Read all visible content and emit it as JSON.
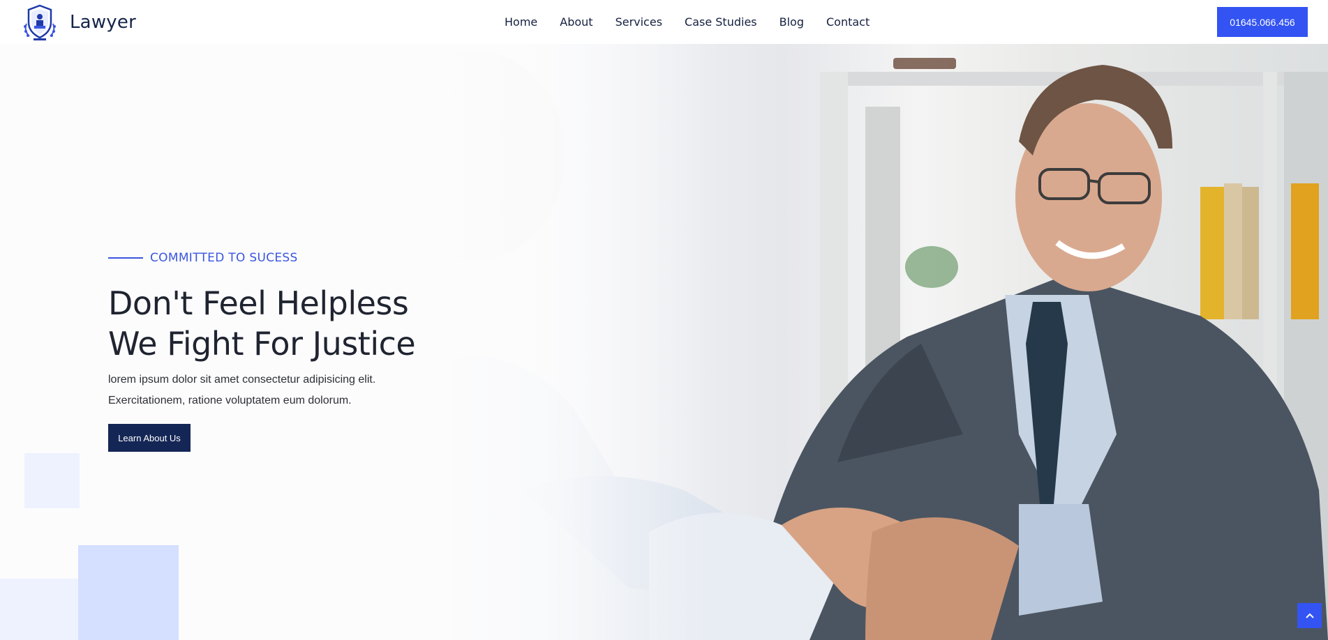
{
  "brand": {
    "name": "Lawyer",
    "logo_icon": "lawyer-shield-emblem-icon"
  },
  "nav": {
    "items": [
      {
        "label": "Home"
      },
      {
        "label": "About"
      },
      {
        "label": "Services"
      },
      {
        "label": "Case Studies"
      },
      {
        "label": "Blog"
      },
      {
        "label": "Contact"
      }
    ]
  },
  "header": {
    "phone_label": "01645.066.456"
  },
  "hero": {
    "eyebrow": "COMMITTED TO SUCESS",
    "heading_line1": "Don't Feel Helpless",
    "heading_line2": "We Fight For Justice",
    "desc_line1": "lorem ipsum dolor sit amet consectetur adipisicing elit.",
    "desc_line2": "Exercitationem, ratione voluptatem eum dolorum.",
    "cta_label": "Learn About Us",
    "image_subject": "smiling lawyer in suit shaking hands"
  },
  "colors": {
    "accent": "#3354f2",
    "navy": "#142655",
    "deco_light": "#eef2ff",
    "deco_medium": "#d5dfff"
  },
  "scroll_top": {
    "icon": "chevron-up-icon"
  }
}
